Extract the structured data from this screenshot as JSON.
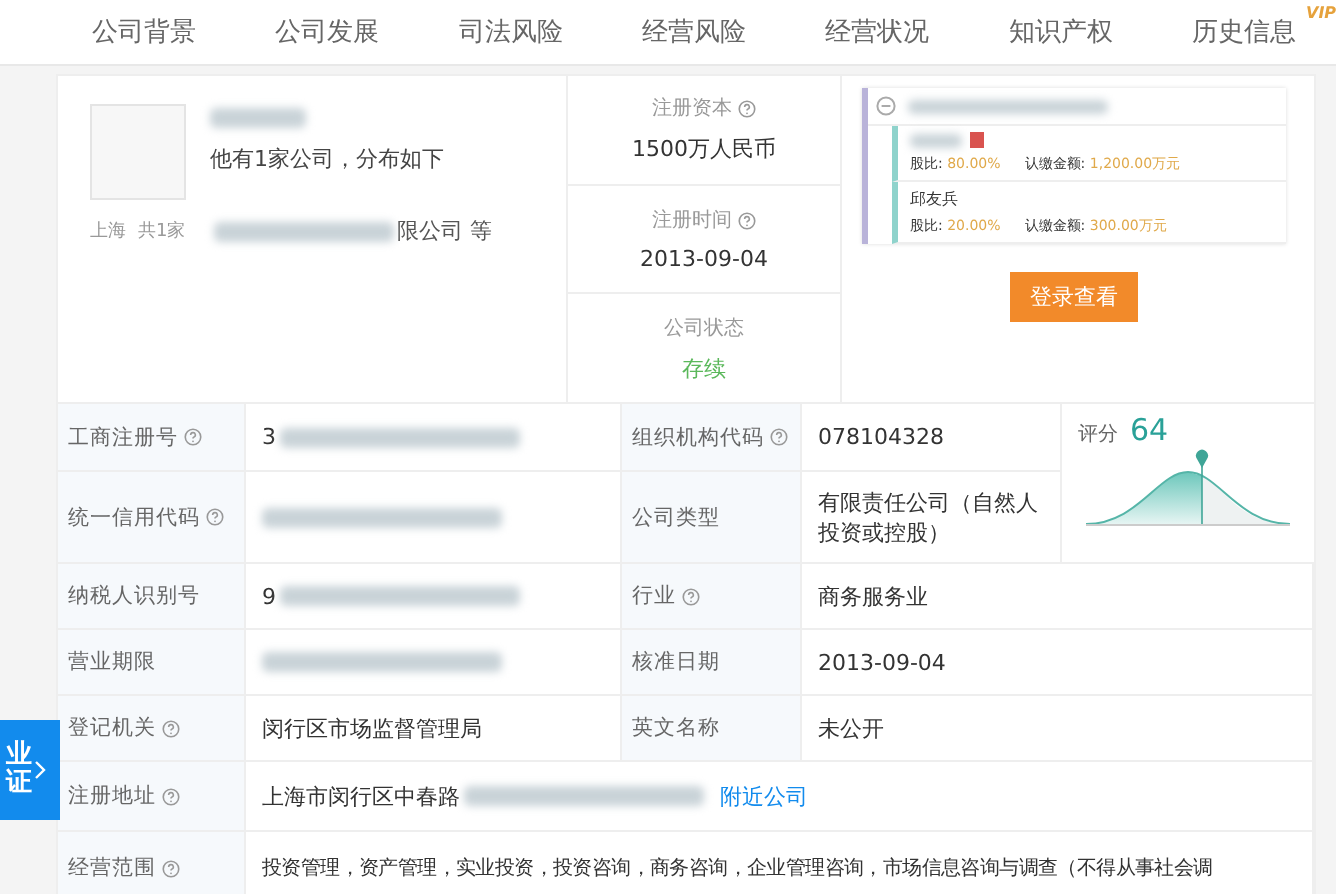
{
  "tabs": [
    {
      "label": "公司背景",
      "selected": false
    },
    {
      "label": "公司发展",
      "selected": false
    },
    {
      "label": "司法风险",
      "selected": false
    },
    {
      "label": "经营风险",
      "selected": false
    },
    {
      "label": "经营状况",
      "selected": false
    },
    {
      "label": "知识产权",
      "selected": false
    },
    {
      "label": "历史信息",
      "selected": false,
      "badge": "VIP"
    }
  ],
  "person": {
    "note": "他有1家公司，分布如下",
    "region": "上海",
    "count": "共1家",
    "company_suffix": "限公司 等"
  },
  "facts": [
    {
      "label": "注册资本",
      "help": true,
      "value": "1500万人民币",
      "kind": "plain"
    },
    {
      "label": "注册时间",
      "help": true,
      "value": "2013-09-04",
      "kind": "plain"
    },
    {
      "label": "公司状态",
      "help": false,
      "value": "存续",
      "kind": "status"
    }
  ],
  "shareholders": [
    {
      "tagged": true,
      "share_label": "股比:",
      "share": "80.00%",
      "amount_label": "认缴金额:",
      "amount": "1,200.00万元"
    },
    {
      "name": "邱友兵",
      "tagged": false,
      "share_label": "股比:",
      "share": "20.00%",
      "amount_label": "认缴金额:",
      "amount": "300.00万元"
    }
  ],
  "login_button": "登录查看",
  "score": {
    "label": "评分",
    "value": "64"
  },
  "rows": [
    {
      "cells": [
        {
          "label": "工商注册号",
          "help": true,
          "value": "3",
          "redacted": true
        },
        {
          "label": "组织机构代码",
          "help": true,
          "value": "078104328",
          "redacted": false
        }
      ]
    },
    {
      "cells": [
        {
          "label": "统一信用代码",
          "help": true,
          "redacted": true
        },
        {
          "label": "公司类型",
          "help": false,
          "value": "有限责任公司（自然人投资或控股）",
          "redacted": false
        }
      ]
    },
    {
      "cells": [
        {
          "label": "纳税人识别号",
          "help": false,
          "value": "9",
          "redacted": true
        },
        {
          "label": "行业",
          "help": true,
          "value": "商务服务业",
          "redacted": false
        }
      ]
    },
    {
      "cells": [
        {
          "label": "营业期限",
          "help": false,
          "redacted": true
        },
        {
          "label": "核准日期",
          "help": false,
          "value": "2013-09-04",
          "redacted": false
        }
      ]
    },
    {
      "cells": [
        {
          "label": "登记机关",
          "help": true,
          "value": "闵行区市场监督管理局",
          "redacted": false
        },
        {
          "label": "英文名称",
          "help": false,
          "value": "未公开",
          "redacted": false
        }
      ]
    },
    {
      "cells": [
        {
          "label": "注册地址",
          "help": true,
          "value": "上海市闵行区中春路",
          "redacted": true,
          "link": "附近公司"
        }
      ]
    },
    {
      "cells": [
        {
          "label": "经营范围",
          "help": true,
          "value": "投资管理，资产管理，实业投资，投资咨询，商务咨询，企业管理咨询，市场信息咨询与调查（不得从事社会调",
          "redacted": false
        }
      ]
    }
  ],
  "side_tab": {
    "label": "业证"
  }
}
